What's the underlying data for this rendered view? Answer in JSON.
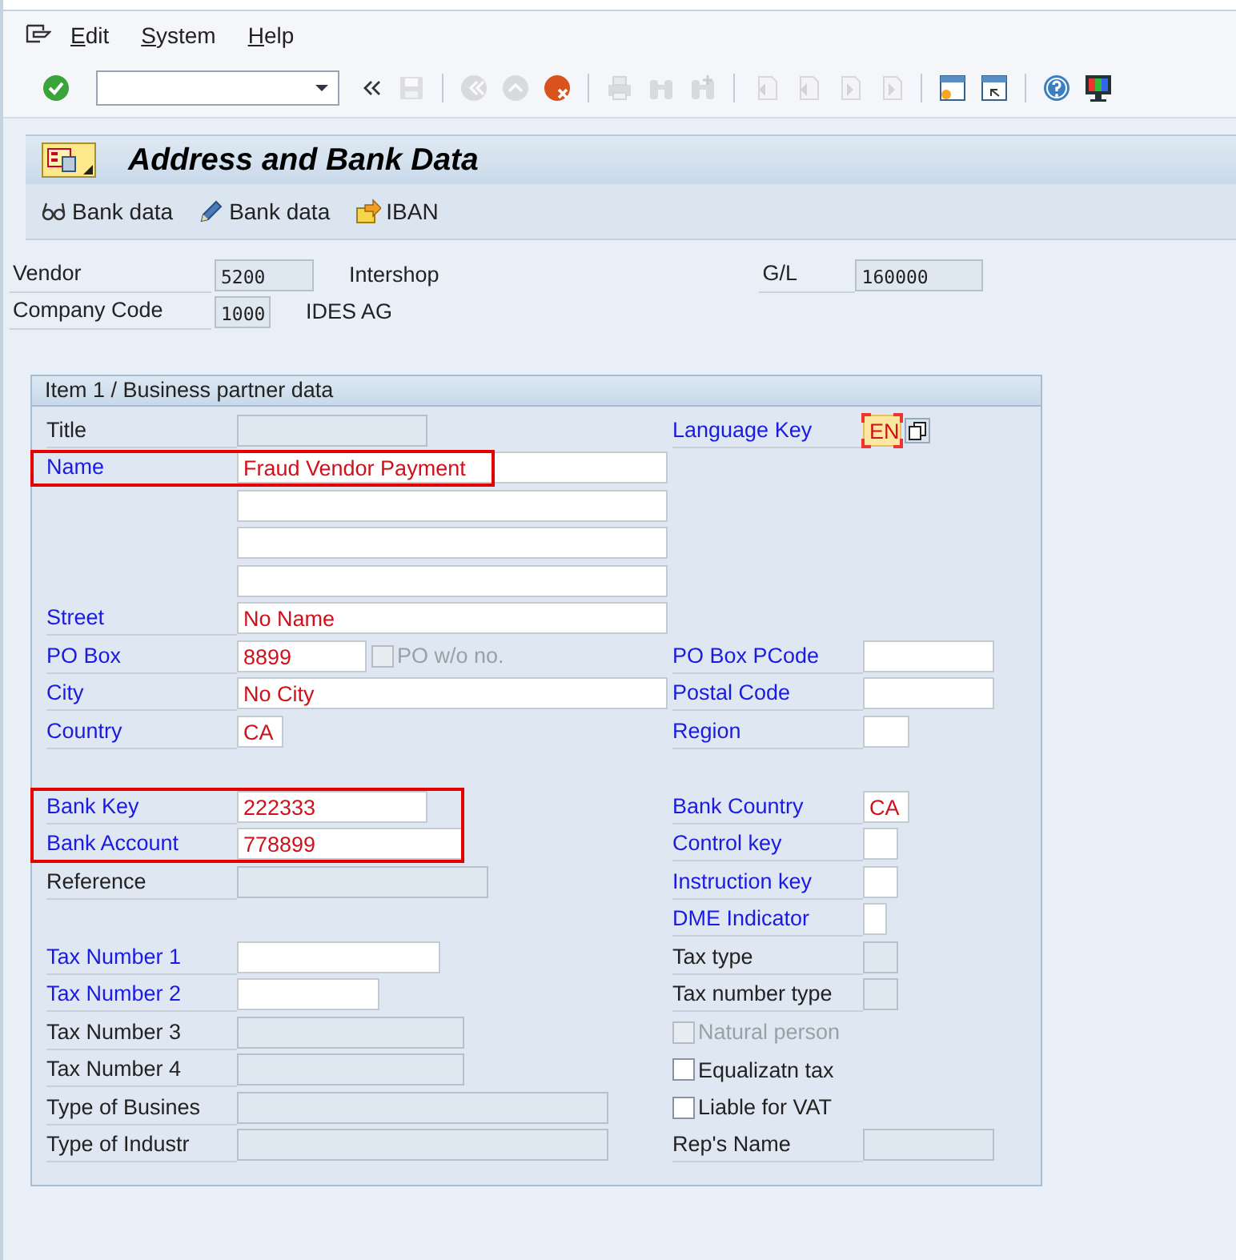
{
  "menu": [
    {
      "label": "Edit"
    },
    {
      "label": "System"
    },
    {
      "label": "Help"
    }
  ],
  "toolbar": [
    {
      "kind": "enter",
      "disabled": false
    },
    {
      "kind": "collapse"
    },
    {
      "kind": "save",
      "disabled": true
    },
    {
      "kind": "sep"
    },
    {
      "kind": "back",
      "disabled": true
    },
    {
      "kind": "exit",
      "disabled": true
    },
    {
      "kind": "cancel",
      "disabled": false
    },
    {
      "kind": "sep"
    },
    {
      "kind": "print",
      "disabled": true
    },
    {
      "kind": "find",
      "disabled": true
    },
    {
      "kind": "find-next",
      "disabled": true
    },
    {
      "kind": "sep"
    },
    {
      "kind": "first-page",
      "disabled": true
    },
    {
      "kind": "previous-page",
      "disabled": true
    },
    {
      "kind": "next-page",
      "disabled": true
    },
    {
      "kind": "last-page",
      "disabled": true
    },
    {
      "kind": "sep"
    },
    {
      "kind": "new-session",
      "disabled": false
    },
    {
      "kind": "shortcut",
      "disabled": false
    },
    {
      "kind": "sep"
    },
    {
      "kind": "help",
      "disabled": false
    },
    {
      "kind": "layout",
      "disabled": false
    }
  ],
  "title": "Address and Bank Data",
  "app_toolbar": [
    {
      "kind": "display",
      "label": "Bank data"
    },
    {
      "kind": "change",
      "label": "Bank data"
    },
    {
      "kind": "iban",
      "label": "IBAN"
    }
  ],
  "header": {
    "rows": [
      {
        "label": "Vendor",
        "value": "5200",
        "description": "Intershop"
      },
      {
        "label": "Company Code",
        "value": "1000",
        "description": "IDES AG"
      }
    ],
    "gl": {
      "label": "G/L",
      "value": "160000"
    }
  },
  "section": {
    "title": "Item 1 / Business partner data",
    "left_groups": [
      {
        "outlined": false,
        "items": [
          {
            "kind": "field",
            "label": "Title",
            "editable": false,
            "marked": false
          }
        ]
      },
      {
        "outlined": true,
        "items": [
          {
            "kind": "field",
            "label": "Name",
            "value": "Fraud Vendor Payment",
            "editable": true,
            "marked": true
          }
        ]
      },
      {
        "outlined": false,
        "items": [
          {
            "kind": "field",
            "editable": true
          },
          {
            "kind": "field",
            "editable": true
          },
          {
            "kind": "field",
            "editable": true
          },
          {
            "kind": "field",
            "label": "Street",
            "value": "No Name",
            "editable": true,
            "marked": true
          },
          {
            "kind": "field",
            "label": "PO Box",
            "value": "8899",
            "editable": true,
            "marked": true,
            "checkbox": {
              "label": "PO w/o no.",
              "checked": false,
              "disabled": true
            }
          },
          {
            "kind": "field",
            "label": "City",
            "value": "No City",
            "editable": true,
            "marked": true
          },
          {
            "kind": "field",
            "label": "Country",
            "value": "CA",
            "editable": true,
            "marked": true
          }
        ]
      },
      {
        "outlined": true,
        "items": [
          {
            "kind": "field",
            "label": "Bank Key",
            "value": "222333",
            "editable": true,
            "marked": true
          },
          {
            "kind": "field",
            "label": "Bank Account",
            "value": "778899",
            "editable": true,
            "marked": true
          }
        ]
      },
      {
        "outlined": false,
        "items": [
          {
            "kind": "field",
            "label": "Reference",
            "editable": false,
            "marked": false
          }
        ]
      },
      {
        "outlined": false,
        "items": [
          {
            "kind": "field",
            "label": "Tax Number 1",
            "editable": true,
            "marked": true
          },
          {
            "kind": "field",
            "label": "Tax Number 2",
            "editable": true,
            "marked": true
          },
          {
            "kind": "field",
            "label": "Tax Number 3",
            "editable": false,
            "marked": false
          },
          {
            "kind": "field",
            "label": "Tax Number 4",
            "editable": false,
            "marked": false
          },
          {
            "kind": "field",
            "label": "Type of Busines",
            "editable": false,
            "marked": false
          },
          {
            "kind": "field",
            "label": "Type of Industr",
            "editable": false,
            "marked": false
          }
        ]
      }
    ],
    "right_groups": [
      {
        "items": [
          {
            "kind": "field",
            "label": "Language Key",
            "value": "EN",
            "editable": true,
            "marked": true,
            "focused": true
          }
        ]
      },
      {
        "items": [
          {
            "kind": "field",
            "label": "PO Box PCode",
            "editable": true,
            "marked": true
          },
          {
            "kind": "field",
            "label": "Postal Code",
            "editable": true,
            "marked": true
          },
          {
            "kind": "field",
            "label": "Region",
            "editable": true,
            "marked": true
          }
        ]
      },
      {
        "items": [
          {
            "kind": "field",
            "label": "Bank Country",
            "value": "CA",
            "editable": true,
            "marked": true
          },
          {
            "kind": "field",
            "label": "Control key",
            "editable": true,
            "marked": true
          },
          {
            "kind": "field",
            "label": "Instruction key",
            "editable": true,
            "marked": true
          },
          {
            "kind": "field",
            "label": "DME Indicator",
            "editable": true,
            "marked": true
          },
          {
            "kind": "field",
            "label": "Tax type",
            "editable": false,
            "marked": false
          },
          {
            "kind": "field",
            "label": "Tax number type",
            "editable": false,
            "marked": false
          },
          {
            "kind": "checkbox",
            "label": "Natural person",
            "checked": false,
            "disabled": true
          },
          {
            "kind": "checkbox",
            "label": "Equalizatn tax",
            "checked": false,
            "disabled": false
          },
          {
            "kind": "checkbox",
            "label": "Liable for VAT",
            "checked": false,
            "disabled": false
          },
          {
            "kind": "field",
            "label": "Rep's Name",
            "editable": false,
            "marked": false
          }
        ]
      }
    ]
  }
}
